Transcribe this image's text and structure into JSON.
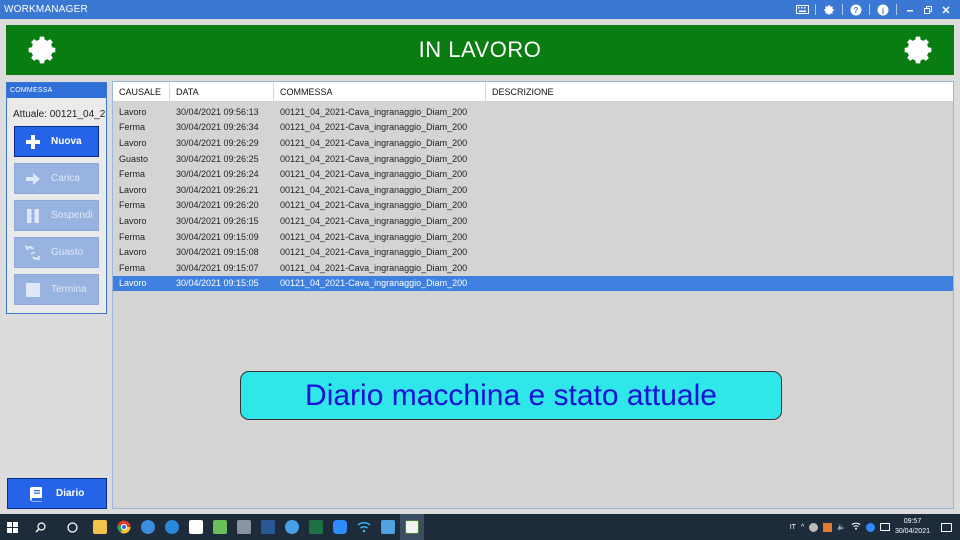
{
  "app": {
    "title": "WORKMANAGER"
  },
  "header": {
    "title": "IN LAVORO"
  },
  "panel": {
    "heading": "COMMESSA",
    "current_label": "Attuale: 00121_04_2",
    "buttons": [
      {
        "label": "Nuova",
        "state": "enabled",
        "icon": "plus-icon"
      },
      {
        "label": "Carica",
        "state": "disabled",
        "icon": "arrow-right-icon"
      },
      {
        "label": "Sospendi",
        "state": "disabled",
        "icon": "pause-icon"
      },
      {
        "label": "Guasto",
        "state": "disabled",
        "icon": "broken-link-icon"
      },
      {
        "label": "Termina",
        "state": "disabled",
        "icon": "stop-icon"
      }
    ],
    "diario_label": "Diario"
  },
  "table": {
    "columns": [
      "CAUSALE",
      "DATA",
      "COMMESSA",
      "DESCRIZIONE"
    ],
    "rows": [
      {
        "causale": "Lavoro",
        "data": "30/04/2021 09:56:13",
        "commessa": "00121_04_2021-Cava_ingranaggio_Diam_200",
        "descrizione": ""
      },
      {
        "causale": "Ferma",
        "data": "30/04/2021 09:26:34",
        "commessa": "00121_04_2021-Cava_ingranaggio_Diam_200",
        "descrizione": ""
      },
      {
        "causale": "Lavoro",
        "data": "30/04/2021 09:26:29",
        "commessa": "00121_04_2021-Cava_ingranaggio_Diam_200",
        "descrizione": ""
      },
      {
        "causale": "Guasto",
        "data": "30/04/2021 09:26:25",
        "commessa": "00121_04_2021-Cava_ingranaggio_Diam_200",
        "descrizione": ""
      },
      {
        "causale": "Ferma",
        "data": "30/04/2021 09:26:24",
        "commessa": "00121_04_2021-Cava_ingranaggio_Diam_200",
        "descrizione": ""
      },
      {
        "causale": "Lavoro",
        "data": "30/04/2021 09:26:21",
        "commessa": "00121_04_2021-Cava_ingranaggio_Diam_200",
        "descrizione": ""
      },
      {
        "causale": "Ferma",
        "data": "30/04/2021 09:26:20",
        "commessa": "00121_04_2021-Cava_ingranaggio_Diam_200",
        "descrizione": ""
      },
      {
        "causale": "Lavoro",
        "data": "30/04/2021 09:26:15",
        "commessa": "00121_04_2021-Cava_ingranaggio_Diam_200",
        "descrizione": ""
      },
      {
        "causale": "Ferma",
        "data": "30/04/2021 09:15:09",
        "commessa": "00121_04_2021-Cava_ingranaggio_Diam_200",
        "descrizione": ""
      },
      {
        "causale": "Lavoro",
        "data": "30/04/2021 09:15:08",
        "commessa": "00121_04_2021-Cava_ingranaggio_Diam_200",
        "descrizione": ""
      },
      {
        "causale": "Ferma",
        "data": "30/04/2021 09:15:07",
        "commessa": "00121_04_2021-Cava_ingranaggio_Diam_200",
        "descrizione": ""
      },
      {
        "causale": "Lavoro",
        "data": "30/04/2021 09:15:05",
        "commessa": "00121_04_2021-Cava_ingranaggio_Diam_200",
        "descrizione": "",
        "selected": true
      }
    ]
  },
  "banner": {
    "text": "Diario macchina e stato attuale"
  },
  "taskbar": {
    "language": "IT",
    "time": "09:57",
    "date": "30/04/2021"
  },
  "colors": {
    "header_green": "#0a7d12",
    "accent_blue": "#2563e8",
    "banner_cyan": "#2fe6e8",
    "banner_text": "#1a10d8"
  }
}
